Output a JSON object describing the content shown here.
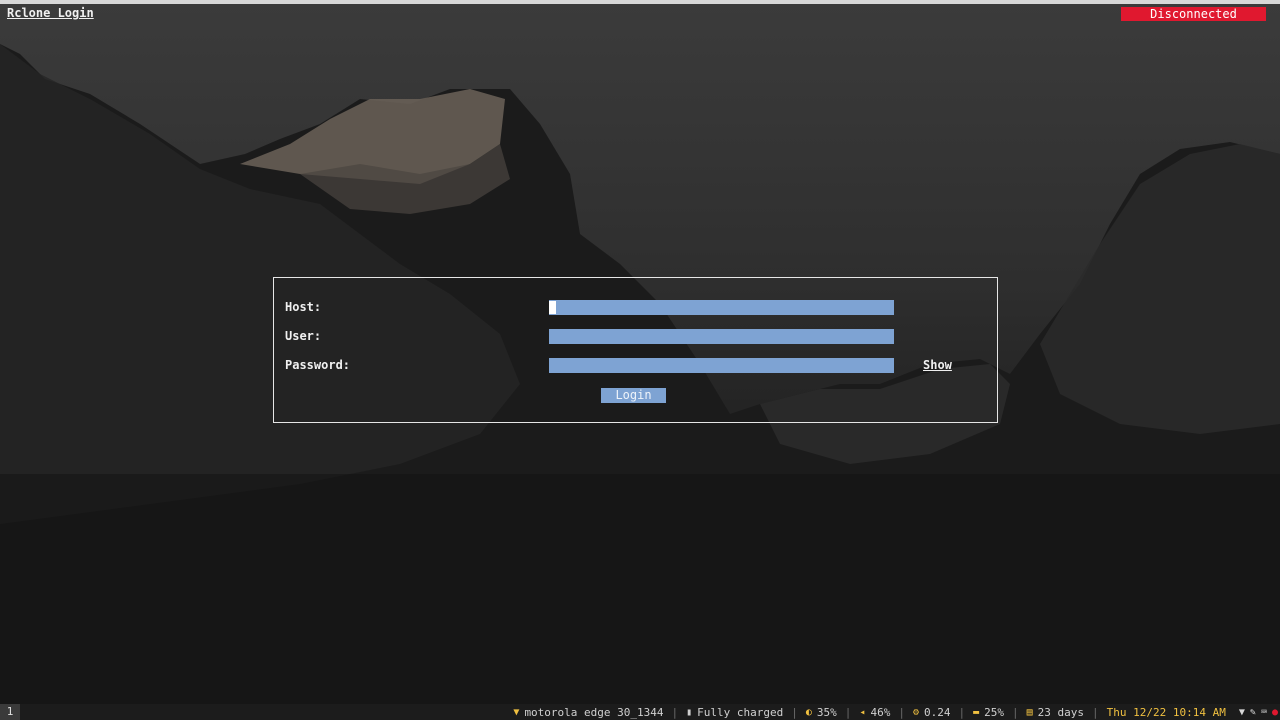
{
  "app": {
    "title": "Rclone Login",
    "connection_status": "Disconnected"
  },
  "form": {
    "host_label": "Host:",
    "user_label": "User:",
    "password_label": "Password:",
    "host_value": "",
    "user_value": "",
    "password_value": "",
    "show_label": "Show",
    "login_label": "Login"
  },
  "statusbar": {
    "workspace": "1",
    "wifi_icon": "wifi-icon",
    "wifi": "motorola edge 30_1344",
    "battery_icon": "battery-icon",
    "battery": "Fully charged",
    "brightness_icon": "brightness-icon",
    "brightness": "35%",
    "volume_icon": "volume-icon",
    "volume": "46%",
    "load_icon": "cpu-load-icon",
    "load": "0.24",
    "memory_icon": "memory-icon",
    "memory": "25%",
    "uptime_icon": "calendar-icon",
    "uptime": "23 days",
    "clock": "Thu 12/22 10:14 AM"
  },
  "colors": {
    "field": "#7ea3d3",
    "disconnected": "#e0182f",
    "clock": "#f0c040",
    "status_icon": "#f0c040"
  }
}
